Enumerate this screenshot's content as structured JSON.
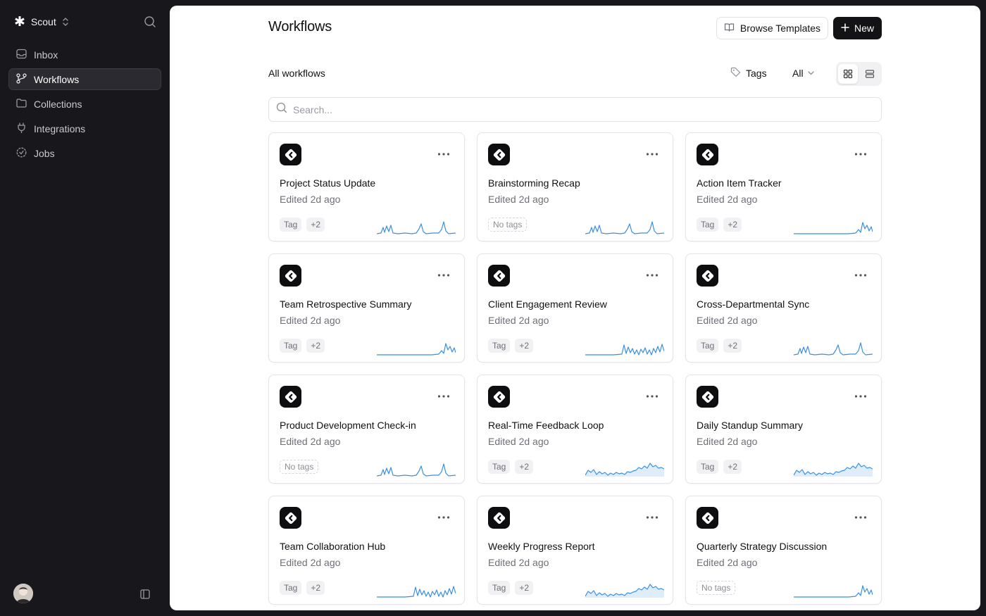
{
  "sidebar": {
    "brand": "Scout",
    "items": [
      {
        "label": "Inbox",
        "icon": "inbox-icon",
        "active": false
      },
      {
        "label": "Workflows",
        "icon": "workflow-icon",
        "active": true
      },
      {
        "label": "Collections",
        "icon": "folder-icon",
        "active": false
      },
      {
        "label": "Integrations",
        "icon": "plug-icon",
        "active": false
      },
      {
        "label": "Jobs",
        "icon": "jobs-icon",
        "active": false
      }
    ]
  },
  "header": {
    "title": "Workflows",
    "browse_label": "Browse Templates",
    "new_label": "New"
  },
  "filters": {
    "section_label": "All workflows",
    "tags_label": "Tags",
    "all_label": "All"
  },
  "search": {
    "placeholder": "Search..."
  },
  "colors": {
    "accent": "#3b8fe0",
    "sparkline": "#3b8fe0",
    "dark": "#131316"
  },
  "cards": [
    {
      "title": "Project Status Update",
      "subtitle": "Edited 2d ago",
      "tags": [
        "Tag",
        "+2"
      ],
      "spark": "spiky"
    },
    {
      "title": "Brainstorming Recap",
      "subtitle": "Edited 2d ago",
      "tags": [],
      "no_tags_label": "No tags",
      "spark": "spiky"
    },
    {
      "title": "Action Item Tracker",
      "subtitle": "Edited 2d ago",
      "tags": [
        "Tag",
        "+2"
      ],
      "spark": "late"
    },
    {
      "title": "Team Retrospective Summary",
      "subtitle": "Edited 2d ago",
      "tags": [
        "Tag",
        "+2"
      ],
      "spark": "late"
    },
    {
      "title": "Client Engagement Review",
      "subtitle": "Edited 2d ago",
      "tags": [
        "Tag",
        "+2"
      ],
      "spark": "busy"
    },
    {
      "title": "Cross-Departmental Sync",
      "subtitle": "Edited 2d ago",
      "tags": [
        "Tag",
        "+2"
      ],
      "spark": "spiky"
    },
    {
      "title": "Product Development Check-in",
      "subtitle": "Edited 2d ago",
      "tags": [],
      "no_tags_label": "No tags",
      "spark": "spiky"
    },
    {
      "title": "Real-Time Feedback Loop",
      "subtitle": "Edited 2d ago",
      "tags": [
        "Tag",
        "+2"
      ],
      "spark": "area"
    },
    {
      "title": "Daily Standup Summary",
      "subtitle": "Edited 2d ago",
      "tags": [
        "Tag",
        "+2"
      ],
      "spark": "area"
    },
    {
      "title": "Team Collaboration Hub",
      "subtitle": "Edited 2d ago",
      "tags": [
        "Tag",
        "+2"
      ],
      "spark": "busy"
    },
    {
      "title": "Weekly Progress Report",
      "subtitle": "Edited 2d ago",
      "tags": [
        "Tag",
        "+2"
      ],
      "spark": "area"
    },
    {
      "title": "Quarterly Strategy Discussion",
      "subtitle": "Edited 2d ago",
      "tags": [],
      "no_tags_label": "No tags",
      "spark": "late"
    }
  ]
}
